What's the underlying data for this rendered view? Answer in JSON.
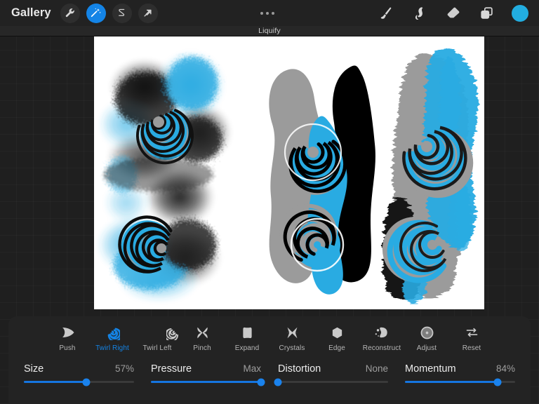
{
  "app": {
    "title": "Liquify",
    "accent": "#1484e6",
    "swatch_color": "#22ade0",
    "canvas_bg": "#ffffff",
    "panel_bg": "#232323"
  },
  "topbar": {
    "gallery_label": "Gallery",
    "left_icons": [
      {
        "name": "wrench-icon",
        "label": "Actions",
        "active": false
      },
      {
        "name": "magic-wand-icon",
        "label": "Adjustments",
        "active": true
      },
      {
        "name": "selection-s-icon",
        "label": "Selection",
        "active": false
      },
      {
        "name": "transform-arrow-icon",
        "label": "Transform",
        "active": false
      }
    ],
    "menu_icon": "more-dots-icon",
    "right_icons": [
      {
        "name": "paintbrush-icon",
        "label": "Paint"
      },
      {
        "name": "smudge-icon",
        "label": "Smudge"
      },
      {
        "name": "eraser-icon",
        "label": "Erase"
      },
      {
        "name": "layers-icon",
        "label": "Layers"
      }
    ],
    "color_swatch_name": "color-swatch"
  },
  "tools": [
    {
      "label": "Push",
      "icon": "push-icon",
      "selected": false
    },
    {
      "label": "Twirl Right",
      "icon": "twirl-right-icon",
      "selected": true
    },
    {
      "label": "Twirl Left",
      "icon": "twirl-left-icon",
      "selected": false
    },
    {
      "label": "Pinch",
      "icon": "pinch-icon",
      "selected": false
    },
    {
      "label": "Expand",
      "icon": "expand-icon",
      "selected": false
    },
    {
      "label": "Crystals",
      "icon": "crystals-icon",
      "selected": false
    },
    {
      "label": "Edge",
      "icon": "edge-icon",
      "selected": false
    },
    {
      "label": "Reconstruct",
      "icon": "reconstruct-icon",
      "selected": false
    },
    {
      "label": "Adjust",
      "icon": "adjust-icon",
      "selected": false
    },
    {
      "label": "Reset",
      "icon": "reset-icon",
      "selected": false
    }
  ],
  "sliders": [
    {
      "name": "Size",
      "value_text": "57%",
      "percent": 57
    },
    {
      "name": "Pressure",
      "value_text": "Max",
      "percent": 100
    },
    {
      "name": "Distortion",
      "value_text": "None",
      "percent": 0
    },
    {
      "name": "Momentum",
      "value_text": "84%",
      "percent": 84
    }
  ],
  "artwork": {
    "description": "Three vertical painting studies on white canvas, each with a Twirl Right liquify spiral applied",
    "palette": {
      "cyan": "#29abe2",
      "gray": "#9b9b9b",
      "black": "#000000",
      "white": "#ffffff"
    },
    "panels": [
      {
        "name": "spray-paint-study",
        "technique": "airbrush spatter",
        "spirals": 2
      },
      {
        "name": "flat-shapes-study",
        "technique": "hard-edged fill",
        "spirals": 2
      },
      {
        "name": "brush-stroke-study",
        "technique": "painterly strokes",
        "spirals": 2
      }
    ]
  }
}
